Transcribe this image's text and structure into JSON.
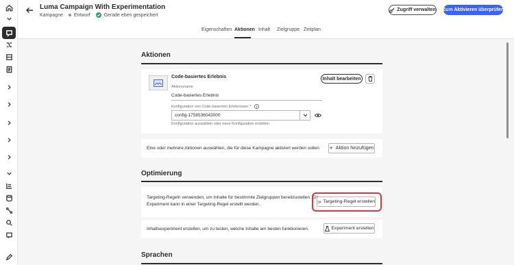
{
  "header": {
    "title": "Luma Campaign With Experimentation",
    "type": "Kampagne",
    "status": "Entwurf",
    "save_status": "Gerade eben gespeichert",
    "manage_access_label": "Zugriff verwalten",
    "review_label": "Zum Aktivieren überprüfen"
  },
  "tabs": [
    {
      "label": "Eigenschaften"
    },
    {
      "label": "Aktionen",
      "active": true
    },
    {
      "label": "Inhalt"
    },
    {
      "label": "Zielgruppe"
    },
    {
      "label": "Zeitplan"
    }
  ],
  "actions": {
    "section_title": "Aktionen",
    "card": {
      "title": "Code-basiertes Erlebnis",
      "name_label": "Aktionsname",
      "name_value": "Code-basiertes Erlebnis",
      "config_label": "Konfiguration von Code-basierten Erlebnissen",
      "required_mark": "*",
      "config_value": "config-1758536043000",
      "config_help": "Konfiguration auswählen oder neue Konfiguration erstellen",
      "edit_content_label": "Inhalt bearbeiten"
    },
    "add_hint": "Eine oder mehrere Aktionen auswählen, die für diese Kampagne aktiviert werden sollen",
    "add_action_label": "Aktion hinzufügen"
  },
  "optimization": {
    "section_title": "Optimierung",
    "targeting_text_1": "Targeting-Regeln verwenden, um Inhalte für bestimmte Zielgruppen bereitzustellen. Ein",
    "targeting_text_2": "Experiment kann in einer Targeting-Regel erstellt werden.",
    "targeting_button": "Targeting-Regel erstellen",
    "experiment_text": "Inhaltsexperiment erstellen, um zu testen, welche Inhalte am besten funktionieren.",
    "experiment_button": "Experiment erstellen"
  },
  "languages": {
    "section_title": "Sprachen"
  },
  "colors": {
    "accent": "#3b63fb",
    "highlight": "#d7373f",
    "saved": "#2d9d78"
  }
}
